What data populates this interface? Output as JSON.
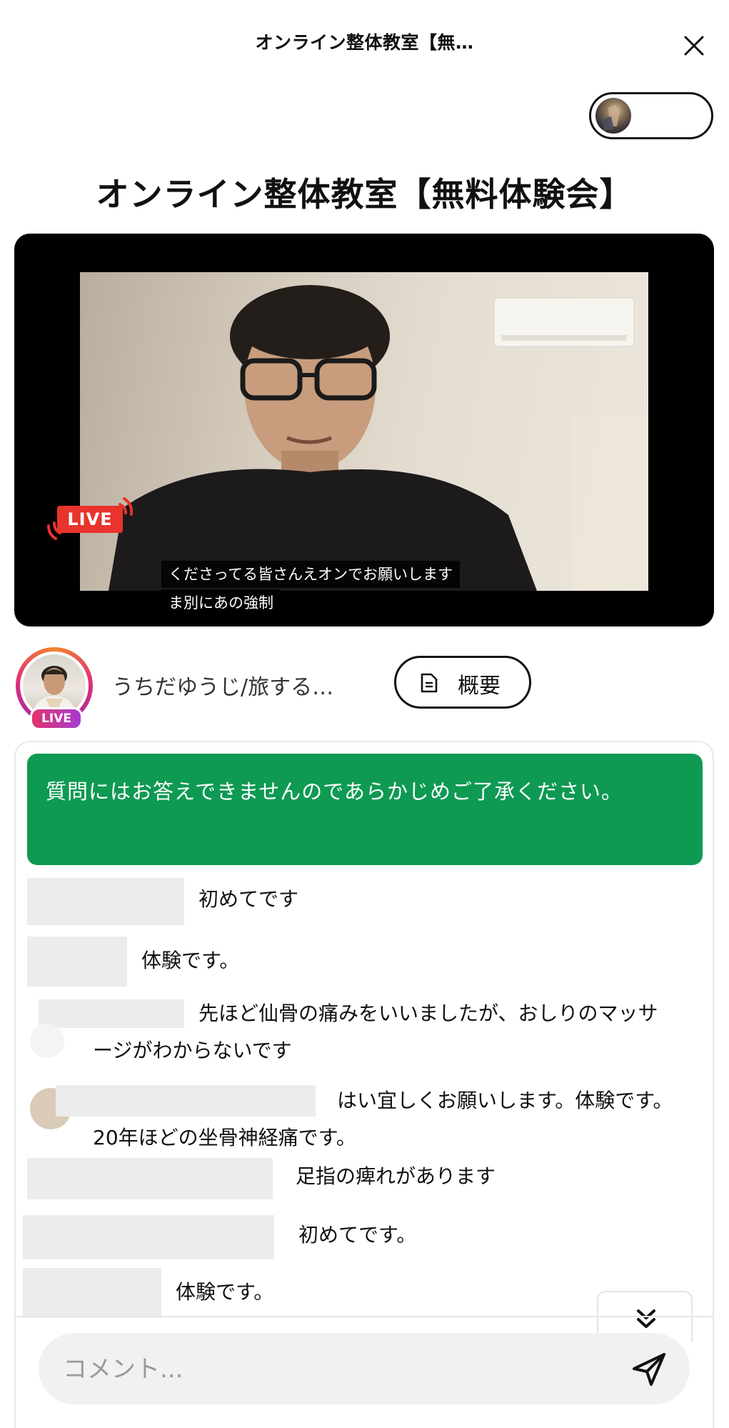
{
  "header": {
    "title": "オンライン整体教室【無…"
  },
  "page": {
    "title": "オンライン整体教室【無料体験会】"
  },
  "video": {
    "live_badge": "LIVE",
    "captions": [
      "くださってる皆さんえオンでお願いします",
      "ま別にあの強制"
    ]
  },
  "host": {
    "name": "うちだゆうじ/旅する…",
    "live_tag": "LIVE",
    "summary_label": "概要"
  },
  "chat": {
    "notice": "質問にはお答えできませんのであらかじめご了承ください。",
    "comments": [
      {
        "text": "初めてです"
      },
      {
        "text": "体験です。"
      },
      {
        "text": "先ほど仙骨の痛みをいいましたが、おしりのマッサ",
        "text2": "ージがわからないです"
      },
      {
        "text": "はい宜しくお願いします。体験です。",
        "text2": "20年ほどの坐骨神経痛です。"
      },
      {
        "text": "足指の痺れがあります"
      },
      {
        "text": "初めてです。"
      },
      {
        "text": "体験です。"
      }
    ]
  },
  "composer": {
    "placeholder": "コメント..."
  },
  "colors": {
    "notice_bg": "#0e9a52",
    "live_red": "#e8342c",
    "live_ring": "#dd2a7b"
  },
  "icons": {
    "close": "close-icon",
    "document": "document-icon",
    "send": "send-icon",
    "scroll_down": "double-chevron-down-icon"
  }
}
